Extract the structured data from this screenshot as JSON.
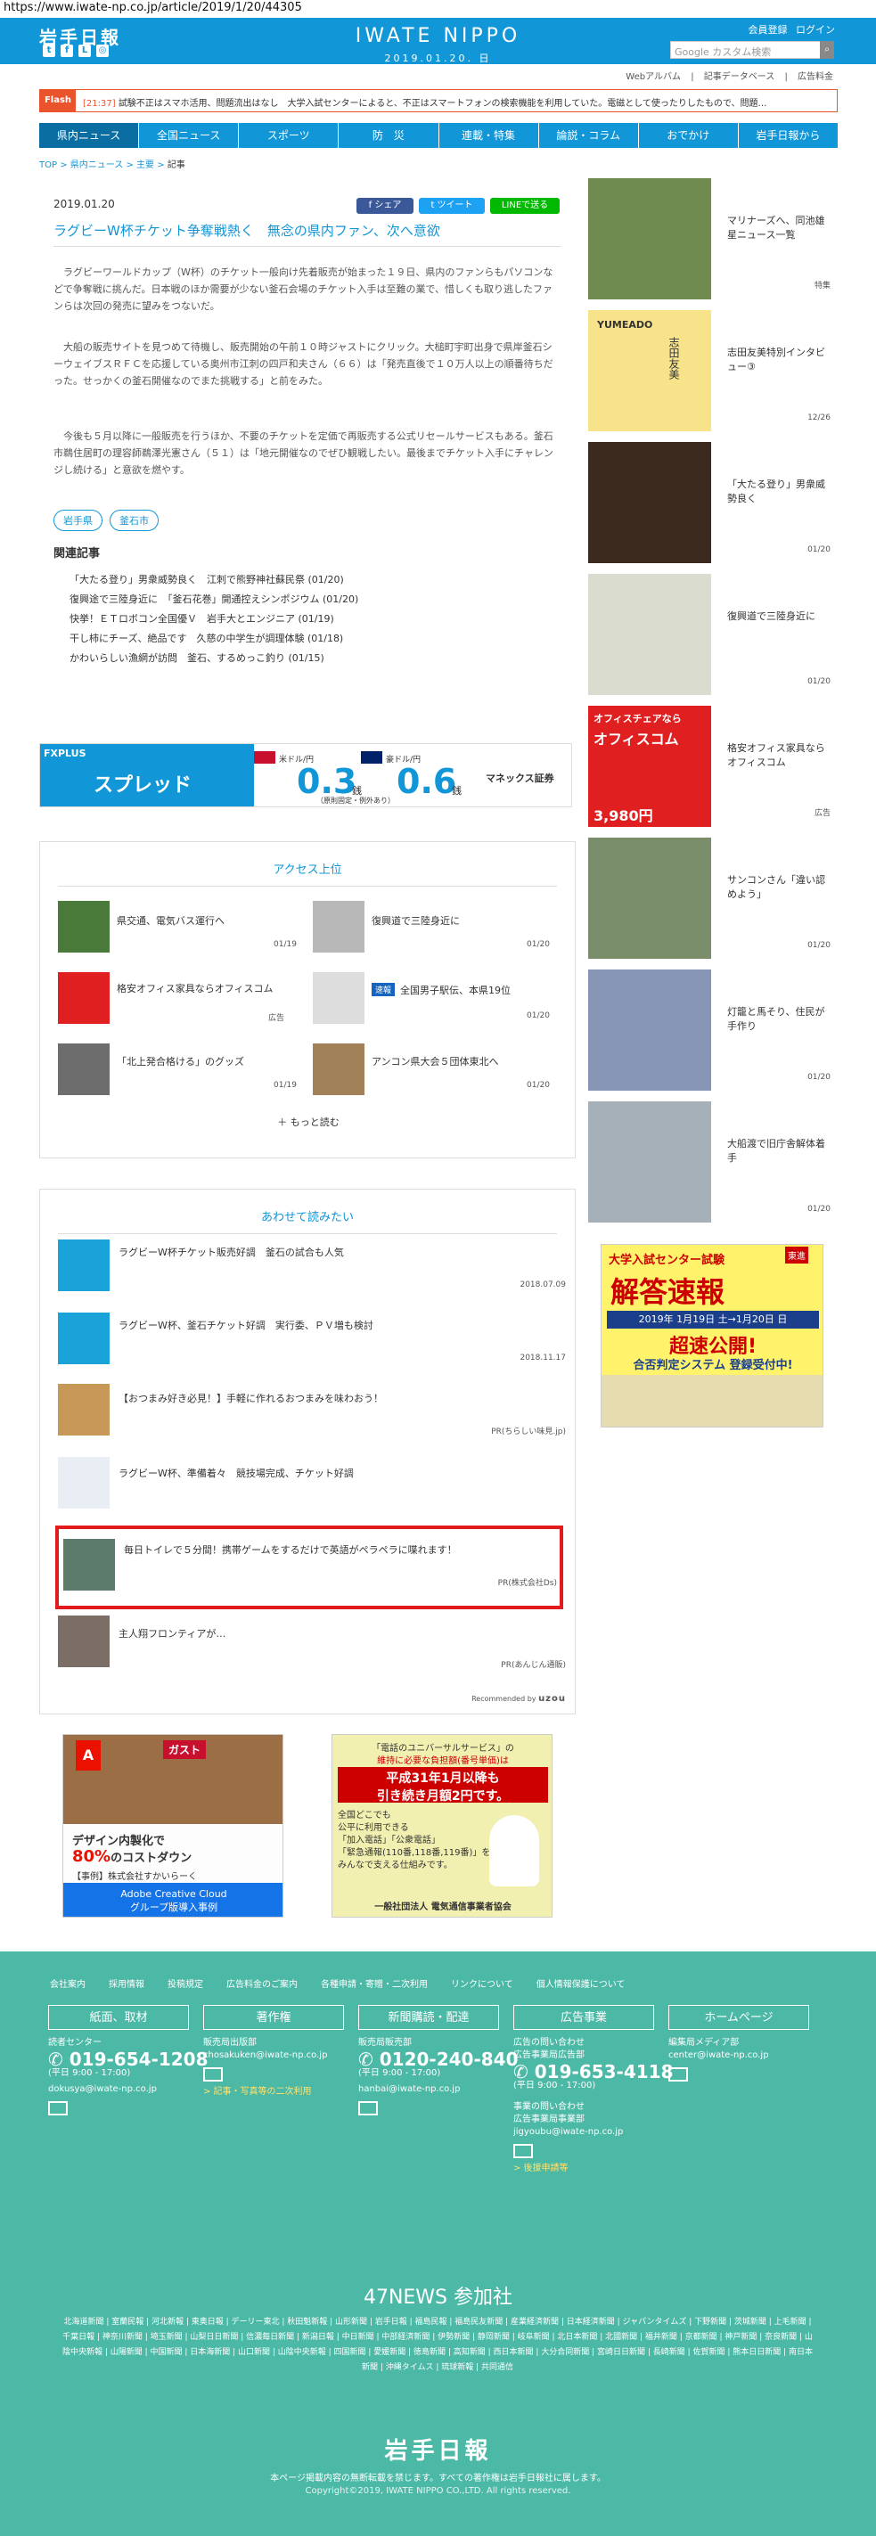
{
  "browser": {
    "url": "https://www.iwate-np.co.jp/article/2019/1/20/44305"
  },
  "header": {
    "logo_jp": "岩手日報",
    "brand": "IWATE NIPPO",
    "date": "2019.01.20. 日",
    "account": [
      "会員登録",
      "ログイン"
    ],
    "search_placeholder": "Google カスタム検索"
  },
  "subnav": [
    "Webアルバム",
    "記事データベース",
    "広告料金"
  ],
  "flash": {
    "tag": "Flash",
    "time": "[21:37]",
    "text": "試験不正はスマホ活用、問題流出はなし　大学入試センターによると、不正はスマートフォンの検索機能を利用していた。電磁として使ったりしたもので、問題…"
  },
  "mainnav": [
    "県内ニュース",
    "全国ニュース",
    "スポーツ",
    "防　災",
    "連載・特集",
    "論説・コラム",
    "おでかけ",
    "岩手日報から"
  ],
  "breadcrumb": {
    "top": "TOP",
    "l1": "県内ニュース",
    "l2": "主要",
    "current": "記事"
  },
  "article": {
    "date": "2019.01.20",
    "share": {
      "fb": "シェア",
      "tw": "ツイート",
      "line": "LINEで送る"
    },
    "title": "ラグビーW杯チケット争奪戦熱く　無念の県内ファン、次へ意欲",
    "paragraphs": [
      "ラグビーワールドカップ（W杯）のチケット一般向け先着販売が始まった１９日、県内のファンらもパソコンなどで争奪戦に挑んだ。日本戦のほか需要が少ない釜石会場のチケット入手は至難の業で、惜しくも取り逃したファンらは次回の発売に望みをつないだ。",
      "大船の販売サイトを見つめて待機し、販売開始の午前１０時ジャストにクリック。大槌町宇町出身で県岸釜石シーウェイブスＲＦＣを応援している奥州市江刺の四戸和夫さん（６６）は「発売直後で１０万人以上の順番待ちだった。せっかくの釜石開催なのでまた挑戦する」と前をみた。",
      "今後も５月以降に一般販売を行うほか、不要のチケットを定価で再販売する公式リセールサービスもある。釜石市鵜住居町の理容師鵜澤光憲さん（５１）は「地元開催なのでぜひ観戦したい。最後までチケット入手にチャレンジし続ける」と意欲を燃やす。"
    ],
    "tags": [
      "岩手県",
      "釜石市"
    ],
    "related_heading": "関連記事",
    "related": [
      "「大たる登り」男衆威勢良く　江刺で熊野神社蘇民祭 (01/20)",
      "復興途で三陸身近に　「釜石花巻」開通控えシンポジウム (01/20)",
      "快挙！ＥＴロボコン全国優Ｖ　岩手大とエンジニア (01/19)",
      "干し柿にチーズ、絶品です　久慈の中学生が調理体験 (01/18)",
      "かわいらしい漁網が訪問　釜石、するめっこ釣り (01/15)"
    ]
  },
  "ad_banner": {
    "brand": "FXPLUS",
    "word": "スプレッド",
    "usd": "0.3",
    "aud": "0.6",
    "unit": "銭",
    "usd_label": "米ドル/円",
    "aud_label": "豪ドル/円",
    "note": "（原則固定・例外あり）",
    "company": "マネックス証券"
  },
  "access": {
    "heading": "アクセス上位",
    "items": [
      {
        "title": "県交通、電気バス運行へ",
        "date": "01/19"
      },
      {
        "title": "復興道で三陸身近に",
        "date": "01/20"
      },
      {
        "title": "格安オフィス家具ならオフィスコム",
        "date": "広告",
        "badge": ""
      },
      {
        "title": "全国男子駅伝、本県19位",
        "date": "01/20",
        "badge": "速報"
      },
      {
        "title": "「北上発合格ける」のグッズ",
        "date": "01/19"
      },
      {
        "title": "アンコン県大会５団体東北へ",
        "date": "01/20"
      }
    ],
    "more": "もっと読む"
  },
  "recommend": {
    "heading": "あわせて読みたい",
    "items": [
      {
        "title": "ラグビーW杯チケット販売好調　釜石の試合も人気",
        "meta": "2018.07.09"
      },
      {
        "title": "ラグビーW杯、釜石チケット好調　実行委、ＰＶ増も検討",
        "meta": "2018.11.17"
      },
      {
        "title": "【おつまみ好き必見！】手軽に作れるおつまみを味わおう！",
        "meta": "PR(ちらしい味見.jp)"
      },
      {
        "title": "ラグビーW杯、準備着々　競技場完成、チケット好調",
        "meta": ""
      },
      {
        "title": "毎日トイレで５分間！携帯ゲームをするだけで英語がペラペラに喋れます！",
        "meta": "PR(株式会社Ds)"
      },
      {
        "title": "主人翔フロンティアが…",
        "meta": "PR(あんじん通販)"
      }
    ],
    "powered": "Recommended by ",
    "powered_brand": "uzou"
  },
  "ads_bottom": {
    "left": {
      "title": "デザイン内製化で",
      "big": "80%",
      "rest": "のコストダウン",
      "case": "【事例】株式会社すかいらーく",
      "product": "Adobe Creative Cloud",
      "product2": "グループ版導入事例",
      "brand": "ガスト"
    },
    "right": {
      "l1": "「電話のユニバーサルサービス」の",
      "l2": "維持に必要な負担額(番号単価)は",
      "l3": "平成31年1月以降も",
      "l4": "引き続き月額2円です。",
      "l5": "全国どこでも",
      "l6": "公平に利用できる",
      "l7": "「加入電話」「公衆電話」",
      "l8": "「緊急通報(110番,118番,119番)」を",
      "l9": "みんなで支える仕組みです。",
      "l10": "一般社団法人 電気通信事業者協会"
    }
  },
  "sidebar": [
    {
      "title": "マリナーズへ、同池雄星ニュース一覧",
      "date": "特集"
    },
    {
      "title": "志田友美特別インタビュー③",
      "date": "12/26",
      "img_text": "YUMEADO",
      "img_name": "志田友美"
    },
    {
      "title": "「大たる登り」男衆威勢良く",
      "date": "01/20"
    },
    {
      "title": "復興道で三陸身近に",
      "date": "01/20"
    },
    {
      "title": "格安オフィス家具ならオフィスコム",
      "date": "広告",
      "img_text": "オフィスチェアなら",
      "img_name": "オフィスコム",
      "price": "3,980円"
    },
    {
      "title": "サンコンさん「違い認めよう」",
      "date": "01/20"
    },
    {
      "title": "灯籠と馬そり、住民が手作り",
      "date": "01/20"
    },
    {
      "title": "大船渡で旧庁舎解体着手",
      "date": "01/20"
    }
  ],
  "side_ad": {
    "top": "大学入試センター試験",
    "brand": "東進",
    "big": "解答速報",
    "dates": "2019年 1月19日 土→1月20日 日",
    "flash": "超速公開!",
    "sub": "合否判定システム 登録受付中!"
  },
  "footer": {
    "links": [
      "会社案内",
      "採用情報",
      "投稿規定",
      "広告料金のご案内",
      "各種申請・寄贈・二次利用",
      "リンクについて",
      "個人情報保護について"
    ],
    "buttons": [
      "紙面、取材",
      "著作権",
      "新聞購読・配達",
      "広告事業",
      "ホームページ"
    ],
    "cols": [
      {
        "l1": "読者センター",
        "tel": "019-654-1208",
        "sub": "(平日 9:00 - 17:00)",
        "mail": "dokusya@iwate-np.co.jp"
      },
      {
        "l1": "販売局出版部",
        "mail": "chosakuken@iwate-np.co.jp",
        "link": "> 記事・写真等の二次利用"
      },
      {
        "l1": "販売局販売部",
        "tel": "0120-240-840",
        "sub": "(平日 9:00 - 17:00)",
        "mail": "hanbai@iwate-np.co.jp"
      },
      {
        "l1": "広告の問い合わせ",
        "l2": "広告事業局広告部",
        "tel": "019-653-4118",
        "sub": "(平日 9:00 - 17:00)",
        "l3": "事業の問い合わせ",
        "l4": "広告事業局事業部",
        "mail": "jigyoubu@iwate-np.co.jp",
        "link": "> 後援申請等"
      },
      {
        "l1": "編集局メディア部",
        "mail": "center@iwate-np.co.jp"
      }
    ],
    "n47": "47NEWS 参加社",
    "n47_list": "北海道新聞 | 室蘭民報 | 河北新報 | 東奥日報 | デーリー東北 | 秋田魁新報 | 山形新聞 | 岩手日報 | 福島民報 | 福島民友新聞 | 産業経済新聞 | 日本経済新聞 | ジャパンタイムズ | 下野新聞 | 茨城新聞 | 上毛新聞 | 千葉日報 | 神奈川新聞 | 埼玉新聞 | 山梨日日新聞 | 信濃毎日新聞 | 新潟日報 | 中日新聞 | 中部経済新聞 | 伊勢新聞 | 静岡新聞 | 岐阜新聞 | 北日本新聞 | 北國新聞 | 福井新聞 | 京都新聞 | 神戸新聞 | 奈良新聞 | 山陰中央新報 | 山陽新聞 | 中国新聞 | 日本海新聞 | 山口新聞 | 山陰中央新報 | 四国新聞 | 愛媛新聞 | 徳島新聞 | 高知新聞 | 西日本新聞 | 大分合同新聞 | 宮崎日日新聞 | 長崎新聞 | 佐賀新聞 | 熊本日日新聞 | 南日本新聞 | 沖縄タイムス | 琉球新報 | 共同通信",
    "logo": "岩手日報",
    "copy1": "本ページ掲載内容の無断転載を禁じます。すべての著作権は岩手日報社に属します。",
    "copy2": "Copyright©2019, IWATE NIPPO CO.,LTD. All rights reserved."
  }
}
